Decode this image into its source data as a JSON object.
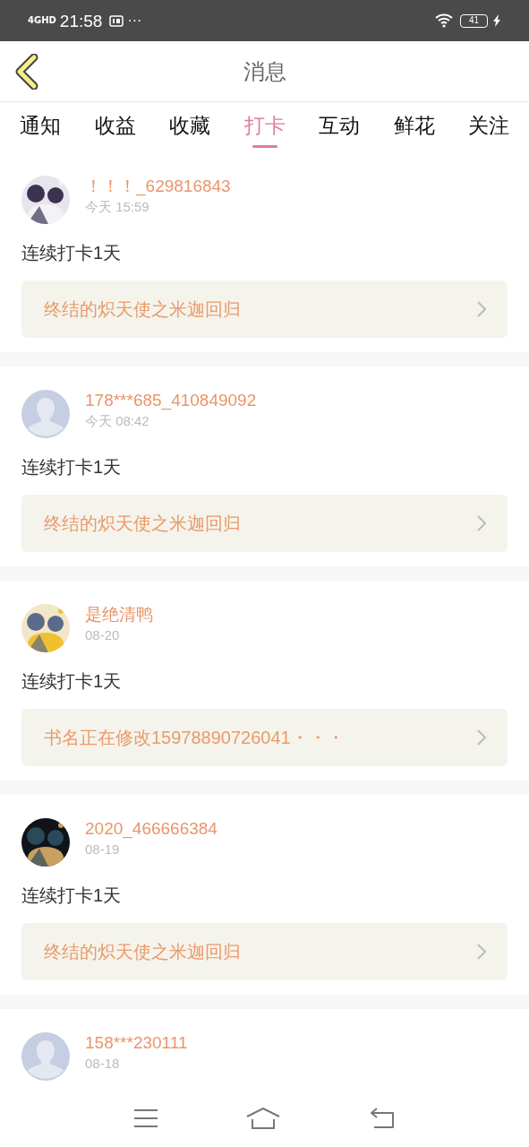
{
  "status_bar": {
    "network": "4GHD",
    "time": "21:58",
    "more": "···",
    "battery": "41"
  },
  "header": {
    "title": "消息"
  },
  "tabs": [
    {
      "label": "通知",
      "selected": false
    },
    {
      "label": "收益",
      "selected": false
    },
    {
      "label": "收藏",
      "selected": false
    },
    {
      "label": "打卡",
      "selected": true
    },
    {
      "label": "互动",
      "selected": false
    },
    {
      "label": "鲜花",
      "selected": false
    },
    {
      "label": "关注",
      "selected": false
    }
  ],
  "messages": [
    {
      "name": "！！！_629816843",
      "time": "今天 15:59",
      "text": "连续打卡1天",
      "book": "终结的炽天使之米迦回归"
    },
    {
      "avatar": {
        "kind": "default"
      },
      "name": "178***685_410849092",
      "time": "今天 08:42",
      "text": "连续打卡1天",
      "book": "终结的炽天使之米迦回归"
    },
    {
      "name": "是绝清鸭",
      "time": "08-20",
      "text": "连续打卡1天",
      "book": "书名正在修改15978890726041・・・"
    },
    {
      "name": "2020_466666384",
      "time": "08-19",
      "text": "连续打卡1天",
      "book": "终结的炽天使之米迦回归"
    },
    {
      "avatar": {
        "kind": "default"
      },
      "name": "158***230111",
      "time": "08-18"
    }
  ]
}
